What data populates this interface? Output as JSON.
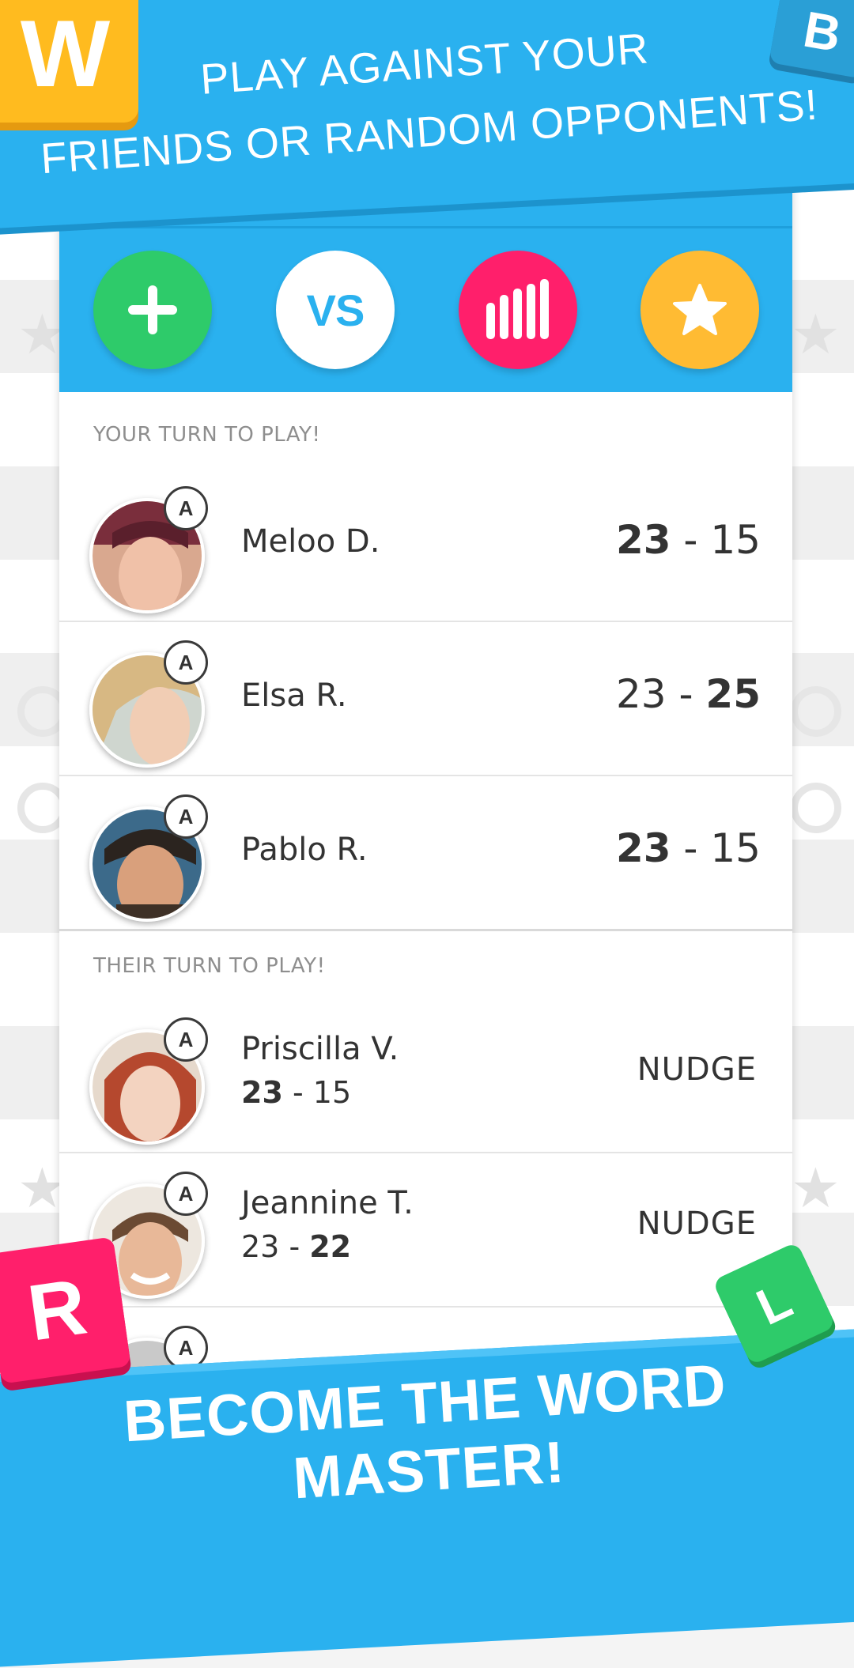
{
  "promo": {
    "top_line1": "PLAY AGAINST YOUR",
    "top_line2": "FRIENDS OR RANDOM OPPONENTS!",
    "bottom": "BECOME THE WORD MASTER!"
  },
  "tiles": [
    "W",
    "B",
    "R",
    "L"
  ],
  "toolbar": {
    "new_game_icon": "plus-icon",
    "versus_label": "VS",
    "stats_icon": "bar-chart-icon",
    "favorites_icon": "star-icon"
  },
  "sections": {
    "your_turn": "YOUR TURN TO PLAY!",
    "their_turn": "THEIR TURN TO PLAY!"
  },
  "your_turn_games": [
    {
      "name": "Meloo D.",
      "badge": "A",
      "score_left": "23",
      "separator": " - ",
      "score_right": "15"
    },
    {
      "name": "Elsa R.",
      "badge": "A",
      "score_left": "23",
      "separator": " - ",
      "score_right": "25"
    },
    {
      "name": "Pablo R.",
      "badge": "A",
      "score_left": "23",
      "separator": " - ",
      "score_right": "15"
    }
  ],
  "their_turn_games": [
    {
      "name": "Priscilla V.",
      "badge": "A",
      "score_left": "23",
      "separator": " - ",
      "score_right": "15",
      "action": "NUDGE"
    },
    {
      "name": "Jeannine T.",
      "badge": "A",
      "score_left": "23",
      "separator": " - ",
      "score_right": "22",
      "action": "NUDGE"
    },
    {
      "badge": "A"
    }
  ],
  "colors": {
    "brand_blue": "#2ab1ef",
    "green": "#2ecb6a",
    "pink": "#ff1f6b",
    "yellow": "#ffbb33"
  }
}
